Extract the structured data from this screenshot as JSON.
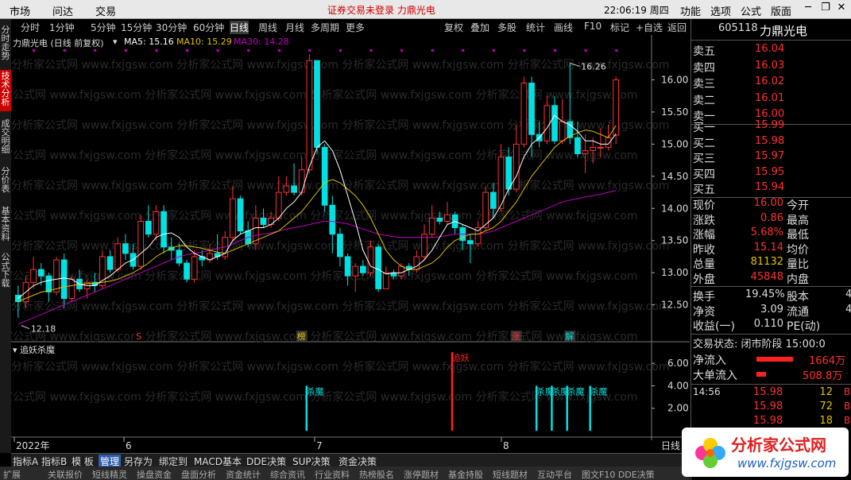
{
  "menu": {
    "market": "市场",
    "ask": "问达",
    "trade": "交易",
    "notice": "证券交易未登录 力鼎光电",
    "clock": "22:06:19 周四",
    "function": "功能",
    "options": "选项",
    "formula": "公式",
    "layout": "版面"
  },
  "periods": [
    "分时",
    "1分钟",
    "5分钟",
    "15分钟",
    "30分钟",
    "60分钟",
    "日线",
    "周线",
    "月线",
    "多周期",
    "更多"
  ],
  "tools": [
    "复权",
    "叠加",
    "多股",
    "统计",
    "画线",
    "F10",
    "标记",
    "+自选",
    "返回"
  ],
  "left_tabs": [
    "分时走势",
    "技术分析",
    "成交明细",
    "分价表",
    "基本资料",
    "公式下载"
  ],
  "chart_header": {
    "name": "力鼎光电 (日线 前复权)",
    "ma5": "MA5: 15.16",
    "ma10": "MA10: 15.29",
    "ma30": "MA30: 14.28"
  },
  "indicator_title": "追妖杀魔",
  "markers": {
    "s": "S",
    "bang": "榜",
    "zhang": "涨",
    "jie": "解",
    "zhuiyao": "追妖",
    "shamo": "杀魔",
    "high": "16.26",
    "low": "12.18"
  },
  "bottom_tabs": [
    "指标A",
    "指标B",
    "模 板",
    "管理",
    "另存为",
    "绑定到",
    "MACD基本",
    "DDE决策",
    "SUP决策",
    "资金决策"
  ],
  "status_tabs": [
    "扩展",
    "关联报价",
    "短线精灵",
    "操盘资金",
    "盘面分析",
    "资金统计",
    "综合资讯",
    "行业资料",
    "热榜股名",
    "涨停题材",
    "基金持股",
    "短线题材",
    "互动平台",
    "图文F10 DDE决策"
  ],
  "axis": {
    "x_labels": [
      "2022年",
      "6",
      "7",
      "8"
    ],
    "period": "日线"
  },
  "quote": {
    "code": "605118",
    "name": "力鼎光电",
    "sell": [
      {
        "label": "卖五",
        "price": "16.04"
      },
      {
        "label": "卖四",
        "price": "16.03"
      },
      {
        "label": "卖三",
        "price": "16.02"
      },
      {
        "label": "卖二",
        "price": "16.01"
      },
      {
        "label": "卖一",
        "price": "16.00"
      }
    ],
    "buy": [
      {
        "label": "买一",
        "price": "15.99"
      },
      {
        "label": "买二",
        "price": "15.98"
      },
      {
        "label": "买三",
        "price": "15.97"
      },
      {
        "label": "买四",
        "price": "15.95"
      },
      {
        "label": "买五",
        "price": "15.94"
      }
    ],
    "stats": [
      {
        "label": "现价",
        "value": "16.00",
        "label2": "今开"
      },
      {
        "label": "涨跌",
        "value": "0.86",
        "label2": "最高"
      },
      {
        "label": "涨幅",
        "value": "5.68%",
        "label2": "最低"
      },
      {
        "label": "昨收",
        "value": "15.14",
        "label2": "均价"
      },
      {
        "label": "总量",
        "value": "81132",
        "label2": "量比"
      },
      {
        "label": "外盘",
        "value": "45848",
        "label2": "内盘"
      }
    ],
    "stats2": [
      {
        "label": "换手",
        "value": "19.45%",
        "label2": "股本",
        "value2": "4"
      },
      {
        "label": "净资",
        "value": "3.09",
        "label2": "流通",
        "value2": "4"
      },
      {
        "label": "收益(一)",
        "value": "0.110",
        "label2": "PE(动)",
        "value2": ""
      }
    ],
    "trade_status": "交易状态: 闭市阶段 15:00:0",
    "net_in": {
      "label": "净流入",
      "value": "1664万"
    },
    "big_in": {
      "label": "大单流入",
      "value": "508.8万"
    },
    "ticks": [
      {
        "time": "14:56",
        "price": "15.98",
        "vol": "12",
        "flag": "B"
      },
      {
        "time": "",
        "price": "15.98",
        "vol": "72",
        "flag": "B"
      },
      {
        "time": "",
        "price": "15.98",
        "vol": "18",
        "flag": "B"
      }
    ]
  },
  "logo": {
    "title": "分析家公式网",
    "url": "www.fxjgsw.com"
  },
  "watermark": "分析家公式网 www.fxjgsw.com",
  "colors": {
    "up": "#ff3030",
    "down": "#00e0e0",
    "ma5": "#ffffff",
    "ma10": "#e0c000",
    "ma30": "#c000c0",
    "accent": "#ff0000"
  },
  "chart_data": {
    "type": "candlestick",
    "y_ticks": [
      16.0,
      15.5,
      15.0,
      14.5,
      14.0,
      13.5,
      13.0,
      12.5
    ],
    "ylim": [
      12.1,
      16.5
    ],
    "indicator_ticks": [
      6.0,
      4.0,
      2.0
    ],
    "indicator_ylim": [
      0,
      7.5
    ],
    "candles": [
      [
        12.65,
        12.55,
        12.8,
        12.3
      ],
      [
        12.55,
        12.85,
        12.95,
        12.45
      ],
      [
        12.85,
        13.05,
        13.25,
        12.75
      ],
      [
        13.05,
        12.95,
        13.15,
        12.8
      ],
      [
        12.95,
        12.7,
        13.0,
        12.55
      ],
      [
        12.7,
        13.2,
        13.25,
        12.65
      ],
      [
        13.2,
        12.6,
        13.3,
        12.45
      ],
      [
        12.6,
        12.9,
        12.95,
        12.55
      ],
      [
        12.9,
        12.75,
        13.05,
        12.7
      ],
      [
        12.75,
        12.85,
        12.9,
        12.6
      ],
      [
        12.85,
        12.8,
        13.0,
        12.7
      ],
      [
        12.8,
        13.25,
        13.35,
        12.75
      ],
      [
        13.25,
        13.05,
        13.35,
        13.0
      ],
      [
        13.05,
        13.45,
        13.55,
        13.0
      ],
      [
        13.45,
        13.3,
        13.6,
        13.2
      ],
      [
        13.3,
        13.1,
        13.45,
        13.05
      ],
      [
        13.1,
        13.8,
        13.9,
        13.05
      ],
      [
        13.8,
        13.6,
        14.05,
        13.55
      ],
      [
        13.6,
        13.95,
        14.05,
        13.5
      ],
      [
        13.95,
        13.4,
        14.05,
        13.3
      ],
      [
        13.4,
        13.35,
        13.55,
        13.2
      ],
      [
        13.35,
        13.15,
        13.45,
        13.1
      ],
      [
        13.15,
        12.9,
        13.2,
        12.85
      ],
      [
        12.9,
        13.25,
        13.35,
        12.85
      ],
      [
        13.25,
        13.2,
        13.35,
        13.1
      ],
      [
        13.2,
        13.3,
        13.45,
        13.15
      ],
      [
        13.3,
        13.25,
        13.6,
        13.2
      ],
      [
        13.25,
        13.55,
        13.65,
        13.2
      ],
      [
        13.55,
        14.15,
        14.35,
        13.5
      ],
      [
        14.15,
        13.65,
        14.2,
        13.6
      ],
      [
        13.65,
        13.45,
        13.8,
        13.4
      ],
      [
        13.45,
        13.85,
        14.05,
        13.35
      ],
      [
        13.85,
        13.75,
        14.0,
        13.7
      ],
      [
        13.75,
        13.85,
        13.95,
        13.7
      ],
      [
        13.85,
        14.25,
        14.5,
        13.8
      ],
      [
        14.25,
        14.35,
        14.5,
        14.2
      ],
      [
        14.35,
        14.25,
        14.7,
        14.2
      ],
      [
        14.25,
        14.6,
        14.8,
        14.2
      ],
      [
        14.6,
        16.3,
        16.4,
        14.55
      ],
      [
        16.3,
        14.95,
        16.15,
        14.85
      ],
      [
        14.95,
        14.05,
        15.0,
        13.95
      ],
      [
        14.05,
        13.6,
        14.2,
        13.3
      ],
      [
        13.6,
        13.25,
        13.7,
        13.1
      ],
      [
        13.25,
        12.95,
        13.3,
        12.8
      ],
      [
        12.95,
        13.1,
        13.15,
        12.7
      ],
      [
        13.1,
        13.0,
        13.2,
        12.95
      ],
      [
        13.0,
        13.4,
        13.5,
        12.95
      ],
      [
        13.4,
        12.75,
        13.45,
        12.7
      ],
      [
        12.75,
        13.0,
        13.1,
        12.75
      ],
      [
        13.0,
        12.95,
        13.05,
        12.9
      ],
      [
        12.95,
        13.1,
        13.15,
        12.9
      ],
      [
        13.1,
        13.05,
        13.15,
        12.95
      ],
      [
        13.05,
        13.25,
        13.35,
        13.0
      ],
      [
        13.25,
        13.6,
        13.75,
        13.2
      ],
      [
        13.6,
        13.85,
        14.05,
        13.55
      ],
      [
        13.85,
        13.8,
        13.95,
        13.75
      ],
      [
        13.8,
        13.9,
        14.1,
        13.75
      ],
      [
        13.9,
        13.7,
        13.95,
        13.6
      ],
      [
        13.7,
        13.5,
        13.75,
        13.35
      ],
      [
        13.5,
        13.45,
        13.6,
        13.15
      ],
      [
        13.45,
        13.7,
        13.8,
        13.4
      ],
      [
        13.7,
        14.25,
        14.35,
        13.65
      ],
      [
        14.25,
        14.0,
        14.4,
        13.85
      ],
      [
        14.0,
        14.8,
        15.0,
        13.95
      ],
      [
        14.8,
        14.3,
        14.95,
        14.2
      ],
      [
        14.3,
        15.0,
        15.3,
        14.25
      ],
      [
        15.0,
        15.95,
        16.05,
        14.95
      ],
      [
        15.95,
        15.15,
        16.05,
        14.8
      ],
      [
        15.15,
        15.05,
        15.35,
        14.95
      ],
      [
        15.05,
        15.6,
        15.75,
        15.0
      ],
      [
        15.6,
        15.05,
        15.75,
        15.0
      ],
      [
        15.05,
        15.35,
        15.7,
        15.0
      ],
      [
        15.35,
        15.1,
        16.26,
        15.0
      ],
      [
        15.1,
        14.85,
        15.35,
        14.8
      ],
      [
        14.85,
        14.9,
        15.15,
        14.55
      ],
      [
        14.9,
        14.95,
        15.1,
        14.7
      ],
      [
        14.95,
        14.95,
        15.25,
        14.8
      ],
      [
        14.95,
        15.1,
        15.3,
        14.9
      ],
      [
        15.14,
        16.0,
        16.05,
        15.0
      ]
    ],
    "ma5": [
      12.6,
      12.7,
      12.8,
      12.85,
      12.88,
      12.9,
      12.92,
      12.9,
      12.82,
      12.8,
      12.8,
      12.88,
      12.95,
      13.05,
      13.15,
      13.2,
      13.3,
      13.4,
      13.55,
      13.6,
      13.62,
      13.55,
      13.4,
      13.3,
      13.25,
      13.2,
      13.25,
      13.3,
      13.5,
      13.6,
      13.65,
      13.7,
      13.7,
      13.75,
      13.85,
      14.0,
      14.1,
      14.25,
      14.65,
      14.95,
      15.05,
      14.9,
      14.6,
      14.2,
      13.8,
      13.35,
      13.1,
      13.05,
      12.98,
      13.0,
      13.0,
      13.05,
      13.1,
      13.2,
      13.35,
      13.55,
      13.75,
      13.8,
      13.75,
      13.7,
      13.65,
      13.75,
      13.85,
      14.05,
      14.3,
      14.5,
      14.8,
      15.0,
      15.1,
      15.25,
      15.45,
      15.35,
      15.3,
      15.2,
      15.05,
      15.05,
      15.0,
      15.0,
      15.16
    ],
    "ma10": [
      12.55,
      12.6,
      12.65,
      12.7,
      12.72,
      12.75,
      12.78,
      12.8,
      12.82,
      12.83,
      12.84,
      12.85,
      12.87,
      12.9,
      12.95,
      13.0,
      13.07,
      13.15,
      13.25,
      13.32,
      13.38,
      13.42,
      13.42,
      13.4,
      13.38,
      13.35,
      13.32,
      13.3,
      13.35,
      13.4,
      13.45,
      13.5,
      13.55,
      13.6,
      13.65,
      13.75,
      13.85,
      13.95,
      14.1,
      14.25,
      14.4,
      14.45,
      14.4,
      14.3,
      14.2,
      14.05,
      13.85,
      13.6,
      13.35,
      13.2,
      13.1,
      13.05,
      13.05,
      13.1,
      13.15,
      13.25,
      13.4,
      13.5,
      13.55,
      13.6,
      13.6,
      13.65,
      13.7,
      13.8,
      13.95,
      14.1,
      14.3,
      14.5,
      14.65,
      14.8,
      14.95,
      15.05,
      15.12,
      15.18,
      15.22,
      15.2,
      15.15,
      15.1,
      15.29
    ],
    "ma30": [
      12.2,
      12.25,
      12.3,
      12.35,
      12.4,
      12.45,
      12.5,
      12.55,
      12.6,
      12.65,
      12.7,
      12.75,
      12.8,
      12.85,
      12.9,
      12.95,
      13.0,
      13.05,
      13.1,
      13.15,
      13.2,
      13.25,
      13.28,
      13.3,
      13.32,
      13.35,
      13.38,
      13.4,
      13.45,
      13.5,
      13.55,
      13.58,
      13.6,
      13.62,
      13.65,
      13.68,
      13.7,
      13.72,
      13.75,
      13.78,
      13.8,
      13.8,
      13.78,
      13.76,
      13.72,
      13.68,
      13.64,
      13.6,
      13.58,
      13.56,
      13.55,
      13.55,
      13.55,
      13.55,
      13.55,
      13.56,
      13.58,
      13.6,
      13.6,
      13.6,
      13.6,
      13.62,
      13.65,
      13.7,
      13.75,
      13.8,
      13.85,
      13.9,
      13.95,
      14.0,
      14.05,
      14.1,
      14.13,
      14.15,
      14.18,
      14.2,
      14.22,
      14.25,
      14.28
    ],
    "signals": [
      {
        "idx": 38,
        "value": 4.0,
        "kind": "shamo"
      },
      {
        "idx": 57,
        "value": 7.0,
        "kind": "zhuiyao"
      },
      {
        "idx": 68,
        "value": 4.0,
        "kind": "shamo"
      },
      {
        "idx": 70,
        "value": 4.0,
        "kind": "shamo"
      },
      {
        "idx": 72,
        "value": 4.0,
        "kind": "shamo"
      },
      {
        "idx": 75,
        "value": 4.0,
        "kind": "shamo"
      }
    ]
  }
}
